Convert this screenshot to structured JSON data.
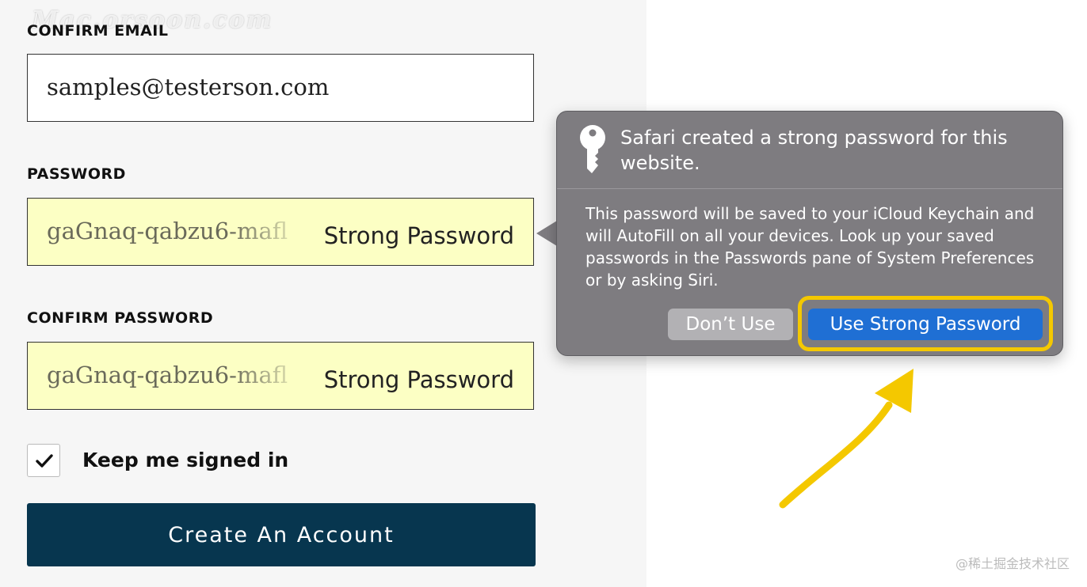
{
  "form": {
    "confirm_email_label": "CONFIRM EMAIL",
    "confirm_email_value": "samples@testerson.com",
    "password_label": "PASSWORD",
    "password_value": "gaGnaq-qabzu6-mafl",
    "password_strength": "Strong Password",
    "confirm_password_label": "CONFIRM PASSWORD",
    "confirm_password_value": "gaGnaq-qabzu6-mafl",
    "confirm_password_strength": "Strong Password",
    "keep_signed_in_label": "Keep me signed in",
    "keep_signed_in_checked": true,
    "create_account_label": "Create An Account"
  },
  "popover": {
    "title": "Safari created a strong password for this website.",
    "body": "This password will be saved to your iCloud Keychain and will AutoFill on all your devices. Look up your saved passwords in the Passwords pane of System Preferences or by asking Siri.",
    "dont_use_label": "Don’t Use",
    "use_strong_label": "Use Strong Password",
    "icon": "key-icon"
  },
  "watermark": "Mac.orsoon.com",
  "credit": "@稀土掘金技术社区",
  "colors": {
    "autofill": "#fcffc4",
    "primary_button": "#07364f",
    "popover_bg": "#7e7c80",
    "accent_blue": "#1f6fd4",
    "highlight": "#f4c800"
  }
}
